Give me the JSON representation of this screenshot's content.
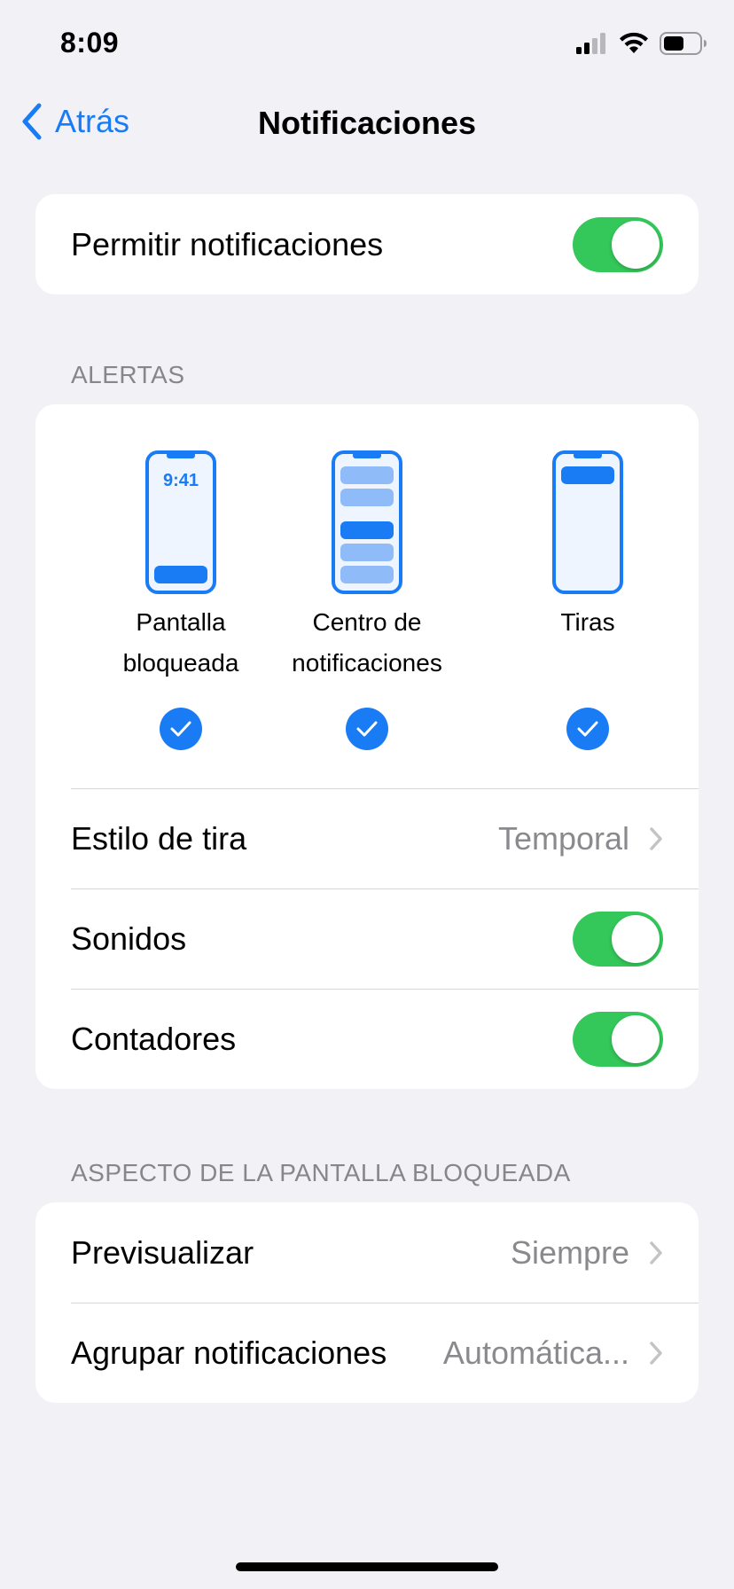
{
  "status_bar": {
    "time": "8:09"
  },
  "nav": {
    "back_label": "Atrás",
    "title": "Notificaciones"
  },
  "allow": {
    "label": "Permitir notificaciones",
    "enabled": true
  },
  "alerts": {
    "header": "ALERTAS",
    "options": [
      {
        "label_line1": "Pantalla",
        "label_line2": "bloqueada",
        "preview_time": "9:41",
        "checked": true
      },
      {
        "label_line1": "Centro de",
        "label_line2": "notificaciones",
        "checked": true
      },
      {
        "label_line1": "Tiras",
        "label_line2": "",
        "checked": true
      }
    ],
    "banner_style": {
      "label": "Estilo de tira",
      "value": "Temporal"
    },
    "sounds": {
      "label": "Sonidos",
      "enabled": true
    },
    "badges": {
      "label": "Contadores",
      "enabled": true
    }
  },
  "lock_screen": {
    "header": "ASPECTO DE LA PANTALLA BLOQUEADA",
    "preview": {
      "label": "Previsualizar",
      "value": "Siempre"
    },
    "grouping": {
      "label": "Agrupar notificaciones",
      "value": "Automática..."
    }
  },
  "colors": {
    "accent": "#1a7cf5",
    "toggle_on": "#34c759",
    "background": "#f2f1f6"
  }
}
